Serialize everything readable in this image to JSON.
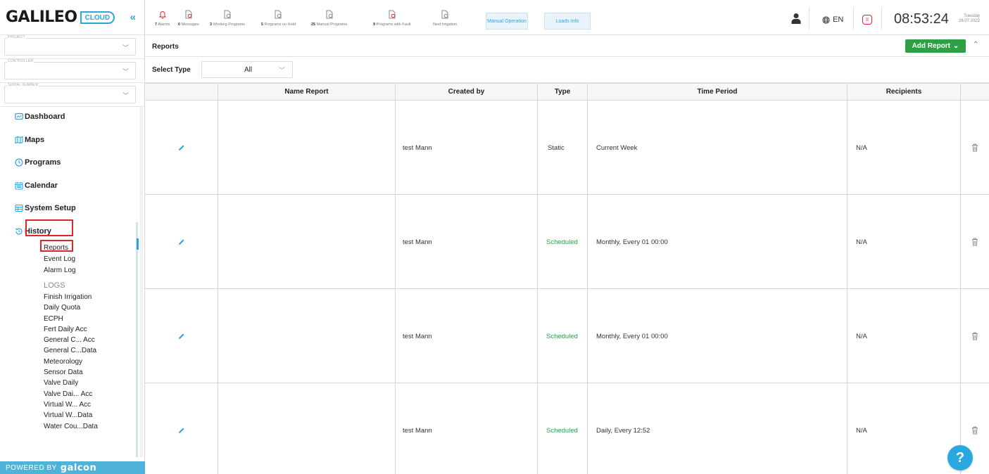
{
  "brand": {
    "name": "GALILEO",
    "cloud": "CLOUD",
    "collapse": "«",
    "powered_by": "POWERED BY",
    "powered_brand": "galcon"
  },
  "selectors": [
    {
      "label": "PROJECT"
    },
    {
      "label": "CONTROLLER"
    },
    {
      "label": "SERIAL NUMBER"
    }
  ],
  "nav": {
    "items": [
      {
        "label": "Dashboard",
        "icon": "dashboard-icon"
      },
      {
        "label": "Maps",
        "icon": "map-icon"
      },
      {
        "label": "Programs",
        "icon": "clock-icon"
      },
      {
        "label": "Calendar",
        "icon": "calendar-icon"
      },
      {
        "label": "System Setup",
        "icon": "system-setup-icon"
      },
      {
        "label": "History",
        "icon": "history-icon"
      }
    ],
    "history_sub": [
      "Reports",
      "Event Log",
      "Alarm Log"
    ],
    "logs_title": "LOGS",
    "logs": [
      "Finish Irrigation",
      "Daily Quota",
      "ECPH",
      "Fert Daily Acc",
      "General C... Acc",
      "General C...Data",
      "Meteorology",
      "Sensor Data",
      "Valve Daily",
      "Valve Dai... Acc",
      "Virtual W... Acc",
      "Virtual W...Data",
      "Water Cou...Data"
    ]
  },
  "topbar": {
    "stats": [
      {
        "count": "7",
        "label": "Alarms",
        "icon": "bell-icon",
        "color": "#e0242c"
      },
      {
        "count": "0",
        "label": "Messages",
        "icon": "message-icon",
        "color": "#e0242c"
      },
      {
        "count": "3",
        "label": "Working Programs",
        "icon": "program-icon",
        "color": "#888888"
      },
      {
        "count": "5",
        "label": "Programs on Hold",
        "icon": "program-icon",
        "color": "#888888"
      },
      {
        "count": "25",
        "label": "Manual Programs",
        "icon": "program-icon",
        "color": "#888888"
      },
      {
        "count": "9",
        "label": "Programs with Fault",
        "icon": "fault-icon",
        "color": "#e0242c"
      },
      {
        "count": "",
        "label": "Next Irrigation",
        "icon": "next-irrigation-icon",
        "color": "#888888"
      }
    ],
    "manual_operation": "Manual Operation",
    "loads_info": "Loads Info",
    "language": "EN",
    "pause": "II",
    "time": "08:53:24",
    "day": "Tuesday",
    "date": "26.07.2022"
  },
  "page": {
    "title": "Reports",
    "add_report": "Add Report",
    "filter_label": "Select Type",
    "filter_value": "All"
  },
  "table": {
    "headers": [
      "",
      "Name Report",
      "Created by",
      "Type",
      "Time Period",
      "Recipients",
      ""
    ],
    "rows": [
      {
        "name": "",
        "created_by": "test Mann",
        "type": "Static",
        "period": "Current Week",
        "recipients": "N/A"
      },
      {
        "name": "",
        "created_by": "test Mann",
        "type": "Scheduled",
        "period": "Monthly, Every 01 00:00",
        "recipients": "N/A"
      },
      {
        "name": "",
        "created_by": "test Mann",
        "type": "Scheduled",
        "period": "Monthly, Every 01 00:00",
        "recipients": "N/A"
      },
      {
        "name": "",
        "created_by": "test Mann",
        "type": "Scheduled",
        "period": "Daily, Every 12:52",
        "recipients": "N/A"
      }
    ]
  },
  "colors": {
    "accent": "#29a8e0",
    "success": "#2ea043",
    "danger": "#e0242c"
  },
  "help": "?"
}
